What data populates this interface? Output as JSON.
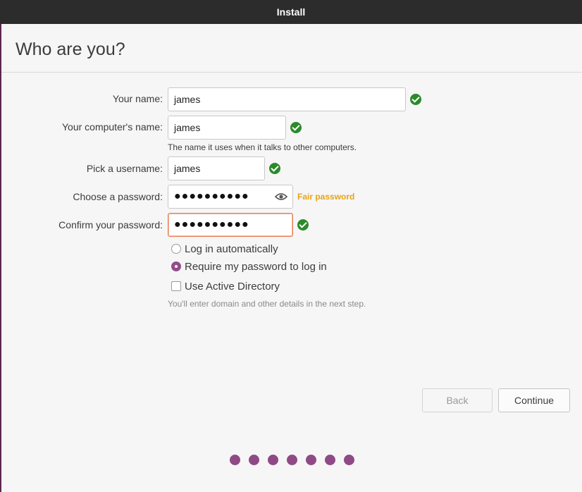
{
  "window": {
    "title": "Install"
  },
  "page": {
    "title": "Who are you?"
  },
  "form": {
    "name_label": "Your name:",
    "name_value": "james",
    "computer_label": "Your computer's name:",
    "computer_value": "james",
    "computer_hint": "The name it uses when it talks to other computers.",
    "username_label": "Pick a username:",
    "username_value": "james",
    "password_label": "Choose a password:",
    "password_value": "●●●●●●●●●●",
    "password_strength": "Fair password",
    "confirm_label": "Confirm your password:",
    "confirm_value": "●●●●●●●●●●"
  },
  "options": {
    "login_auto": "Log in automatically",
    "require_password": "Require my password to log in",
    "selected": "require_password",
    "active_directory": "Use Active Directory",
    "active_directory_checked": false,
    "ad_hint": "You'll enter domain and other details in the next step."
  },
  "buttons": {
    "back": "Back",
    "continue": "Continue"
  },
  "progress": {
    "total_steps": 7
  },
  "colors": {
    "accent": "#924d8b",
    "valid": "#2b8a2b",
    "strength_fair": "#e8a317",
    "focus_border": "#e97f5a"
  }
}
